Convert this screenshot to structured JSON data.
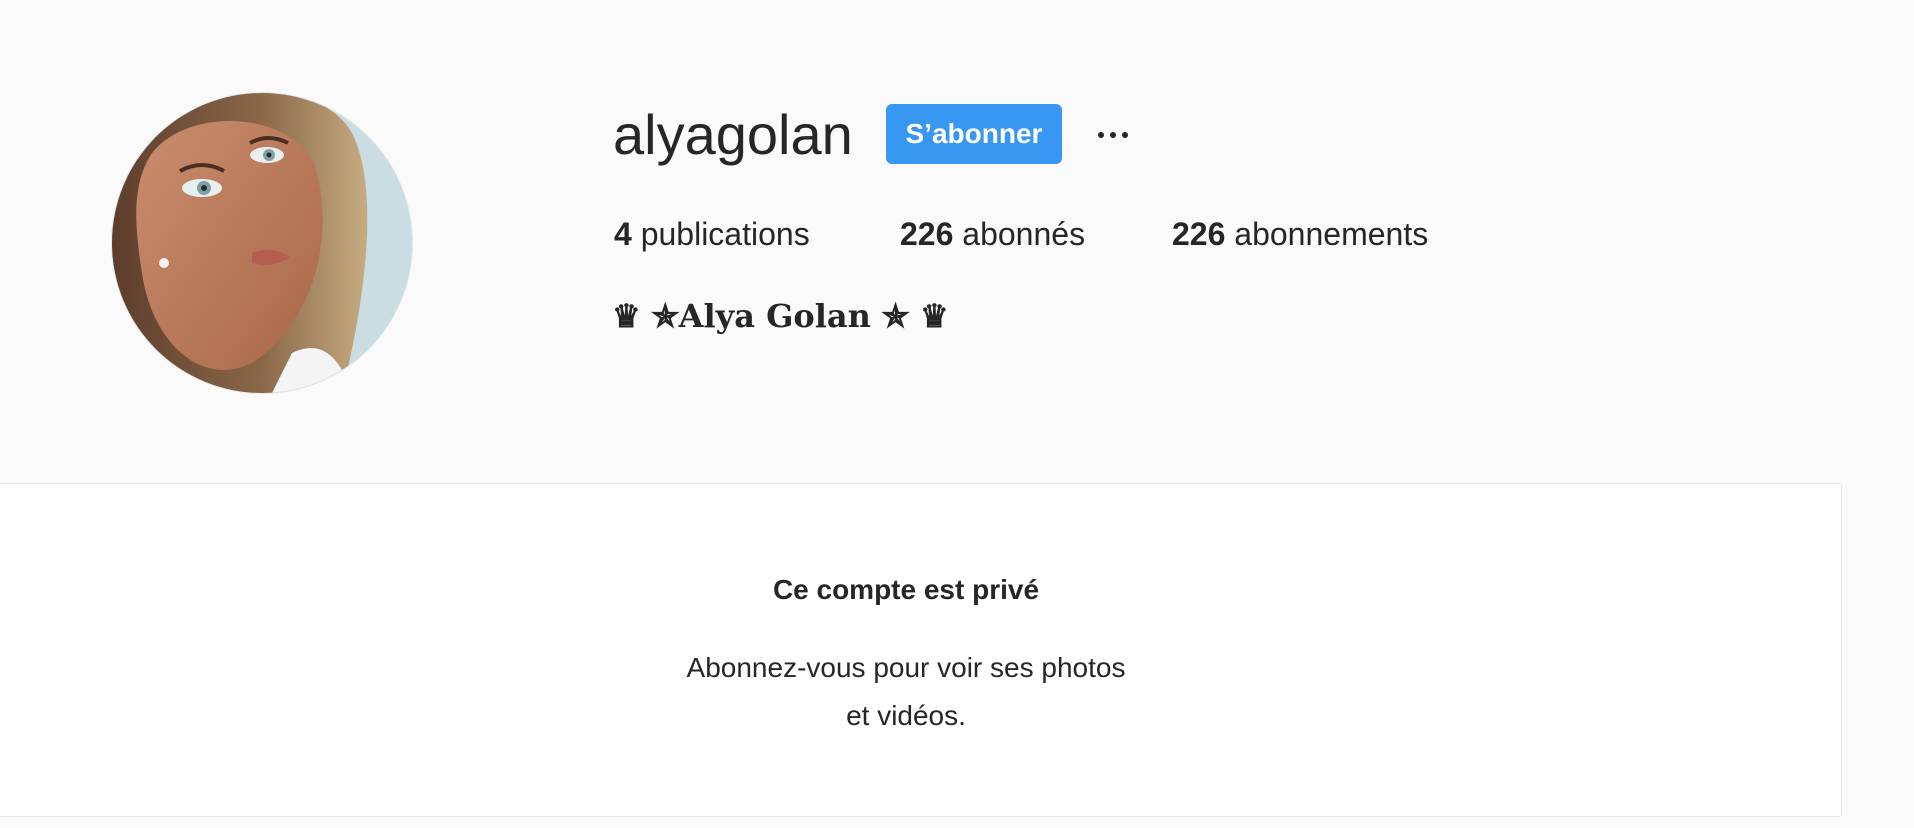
{
  "profile": {
    "username": "alyagolan",
    "follow_label": "S’abonner",
    "more_icon": "ellipsis-icon",
    "avatar_icon": "profile-photo",
    "stats": {
      "posts_count": "4",
      "posts_label": "publications",
      "followers_count": "226",
      "followers_label": "abonnés",
      "following_count": "226",
      "following_label": "abonnements"
    },
    "bio": "♛ ✯Alya Golan ✯ ♛"
  },
  "private_notice": {
    "title": "Ce compte est privé",
    "line1": "Abonnez-vous pour voir ses photos",
    "line2": "et vidéos."
  },
  "colors": {
    "accent": "#3897f0",
    "background": "#fafafa",
    "text": "#262626"
  }
}
